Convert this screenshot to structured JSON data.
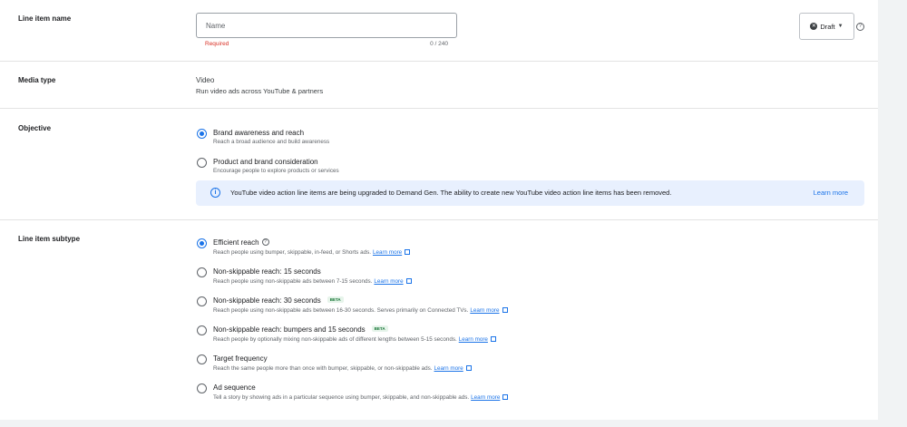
{
  "line_item_name": {
    "label": "Line item name",
    "placeholder": "Name",
    "value": "",
    "error": "Required",
    "counter": "0 / 240"
  },
  "status": {
    "label": "Draft",
    "icon": "x-circle-icon"
  },
  "media_type": {
    "label": "Media type",
    "value": "Video",
    "description": "Run video ads across YouTube & partners"
  },
  "objective": {
    "label": "Objective",
    "options": [
      {
        "title": "Brand awareness and reach",
        "description": "Reach a broad audience and build awareness",
        "selected": true
      },
      {
        "title": "Product and brand consideration",
        "description": "Encourage people to explore products or services",
        "selected": false
      }
    ],
    "notice": {
      "text": "YouTube video action line items are being upgraded to Demand Gen. The ability to create new YouTube video action line items has been removed.",
      "link": "Learn more"
    }
  },
  "subtype": {
    "label": "Line item subtype",
    "learn_more": "Learn more",
    "beta": "BETA",
    "options": [
      {
        "title": "Efficient reach",
        "description": "Reach people using bumper, skippable, in-feed, or Shorts ads.",
        "selected": true
      },
      {
        "title": "Non-skippable reach: 15 seconds",
        "description": "Reach people using non-skippable ads between 7-15 seconds.",
        "selected": false
      },
      {
        "title": "Non-skippable reach: 30 seconds",
        "description": "Reach people using non-skippable ads between 16-30 seconds. Serves primarily on Connected TVs.",
        "selected": false
      },
      {
        "title": "Non-skippable reach: bumpers and 15 seconds",
        "description": "Reach people by optionally mixing non-skippable ads of different lengths between 5-15 seconds.",
        "selected": false
      },
      {
        "title": "Target frequency",
        "description": "Reach the same people more than once with bumper, skippable, or non-skippable ads.",
        "selected": false
      },
      {
        "title": "Ad sequence",
        "description": "Tell a story by showing ads in a particular sequence using bumper, skippable, and non-skippable ads.",
        "selected": false
      }
    ]
  },
  "colors": {
    "accent": "#1a73e8",
    "error": "#d93025",
    "notice_bg": "#e8f0fe",
    "beta_bg": "#e6f4ea"
  }
}
